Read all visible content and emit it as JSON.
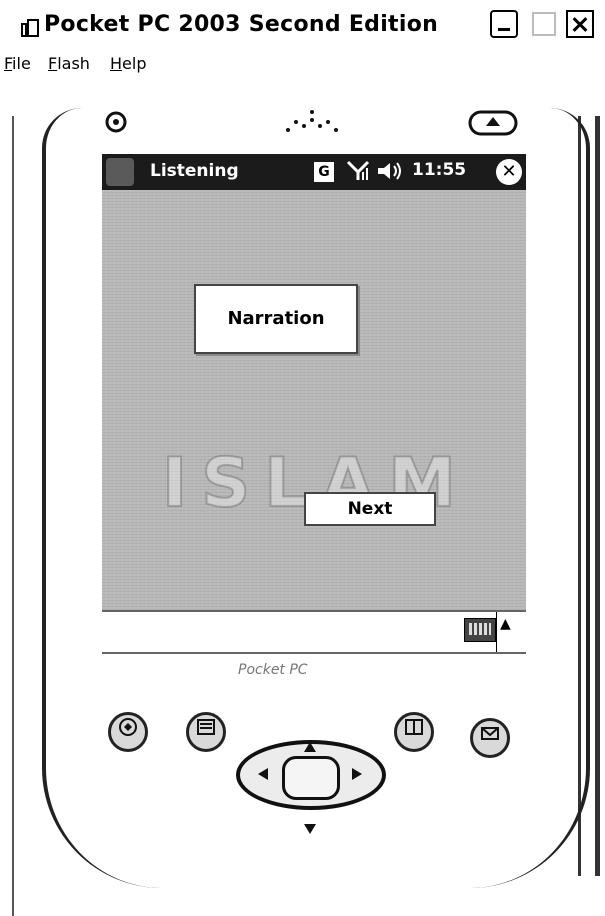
{
  "window": {
    "title": "Pocket PC 2003 Second Edition",
    "menu": [
      {
        "label": "File"
      },
      {
        "label": "Flash"
      },
      {
        "label": "Help"
      }
    ]
  },
  "device": {
    "statusbar": {
      "title": "Listening",
      "g_badge": "G",
      "signal": "Yıl",
      "volume": "◀&",
      "time": "11:55",
      "close": "✕"
    },
    "screen": {
      "watermark": "ISLAM",
      "narration_label": "Narration",
      "next_label": "Next"
    },
    "sip": {
      "arrow": "▲"
    },
    "brand": "Pocket PC"
  }
}
